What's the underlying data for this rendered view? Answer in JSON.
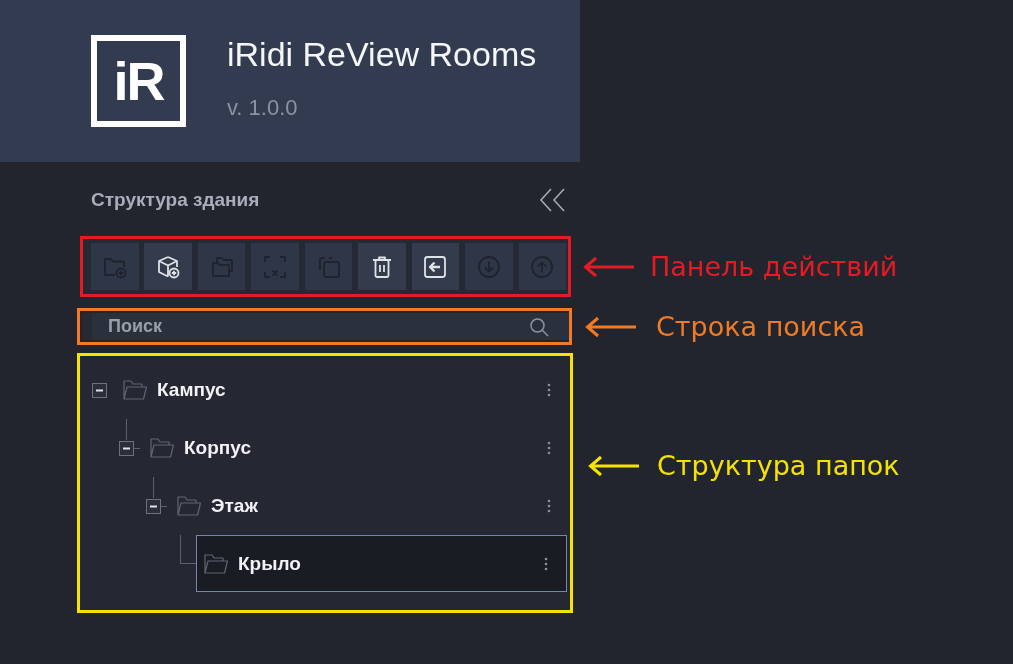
{
  "header": {
    "logo_text": "iR",
    "title": "iRidi ReView Rooms",
    "version": "v. 1.0.0"
  },
  "panel": {
    "title": "Структура здания"
  },
  "toolbar": {
    "buttons": [
      {
        "disabled": true
      },
      {
        "disabled": false
      },
      {
        "disabled": true
      },
      {
        "disabled": true
      },
      {
        "disabled": true
      },
      {
        "disabled": false
      },
      {
        "disabled": false
      },
      {
        "disabled": true
      },
      {
        "disabled": true
      }
    ]
  },
  "search": {
    "placeholder": "Поиск"
  },
  "tree": {
    "items": [
      {
        "label": "Кампус",
        "expanded": true,
        "selected": false,
        "children": [
          {
            "label": "Корпус",
            "expanded": true,
            "selected": false,
            "children": [
              {
                "label": "Этаж",
                "expanded": true,
                "selected": false,
                "children": [
                  {
                    "label": "Крыло",
                    "selected": true
                  }
                ]
              }
            ]
          }
        ]
      }
    ]
  },
  "callouts": [
    {
      "label": "Панель действий",
      "color": "#e31b23"
    },
    {
      "label": "Строка поиска",
      "color": "#f07b24"
    },
    {
      "label": "Структура папок",
      "color": "#f5e400"
    }
  ]
}
